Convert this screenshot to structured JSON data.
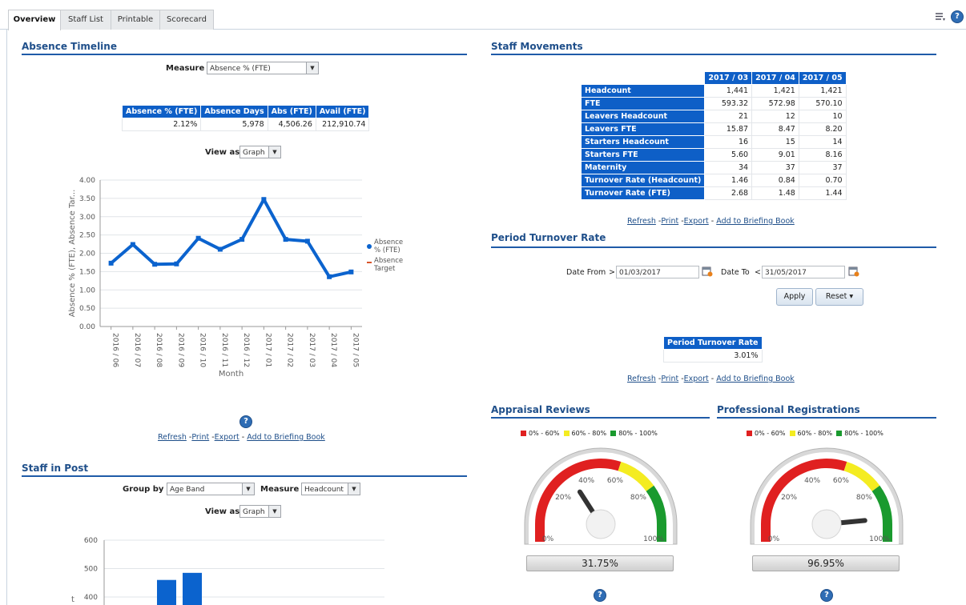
{
  "tabs": [
    "Overview",
    "Staff List",
    "Printable",
    "Scorecard"
  ],
  "absence_timeline": {
    "title": "Absence Timeline",
    "measure_label": "Measure",
    "measure_value": "Absence % (FTE)",
    "summary_headers": [
      "Absence % (FTE)",
      "Absence Days",
      "Abs (FTE)",
      "Avail (FTE)"
    ],
    "summary_values": [
      "2.12%",
      "5,978",
      "4,506.26",
      "212,910.74"
    ],
    "view_as_label": "View as",
    "view_as_value": "Graph",
    "links": {
      "refresh": "Refresh",
      "print": "Print",
      "export": "Export",
      "briefing": "Add to Briefing Book"
    }
  },
  "chart_data": {
    "type": "line",
    "categories": [
      "2016 / 06",
      "2016 / 07",
      "2016 / 08",
      "2016 / 09",
      "2016 / 10",
      "2016 / 11",
      "2016 / 12",
      "2017 / 01",
      "2017 / 02",
      "2017 / 03",
      "2017 / 04",
      "2017 / 05"
    ],
    "series": [
      {
        "name": "Absence % (FTE)",
        "values": [
          1.73,
          2.24,
          1.7,
          1.71,
          2.41,
          2.11,
          2.38,
          3.47,
          2.38,
          2.33,
          1.36,
          1.49
        ]
      },
      {
        "name": "Absence Target",
        "values": []
      }
    ],
    "ylabel": "Absence % (FTE), Absence Tar...",
    "xlabel": "Month",
    "ylim": [
      0,
      4
    ],
    "yticks": [
      "0.00",
      "0.50",
      "1.00",
      "1.50",
      "2.00",
      "2.50",
      "3.00",
      "3.50",
      "4.00"
    ],
    "legend": [
      "Absence % (FTE)",
      "Absence Target"
    ],
    "legend_position": "right",
    "colors": {
      "series": "#0b63ce",
      "target": "#d9542a"
    }
  },
  "staff_in_post": {
    "title": "Staff in Post",
    "group_by_label": "Group by",
    "group_by_value": "Age Band",
    "measure_label": "Measure",
    "measure_value": "Headcount",
    "view_as_label": "View as",
    "view_as_value": "Graph",
    "yticks": [
      "600",
      "500",
      "400"
    ],
    "ylabel_fragment": "t",
    "bars": [
      460,
      485
    ]
  },
  "staff_movements": {
    "title": "Staff Movements",
    "columns": [
      "2017 / 03",
      "2017 / 04",
      "2017 / 05"
    ],
    "rows": [
      {
        "label": "Headcount",
        "values": [
          "1,441",
          "1,421",
          "1,421"
        ]
      },
      {
        "label": "FTE",
        "values": [
          "593.32",
          "572.98",
          "570.10"
        ]
      },
      {
        "label": "Leavers Headcount",
        "values": [
          "21",
          "12",
          "10"
        ]
      },
      {
        "label": "Leavers FTE",
        "values": [
          "15.87",
          "8.47",
          "8.20"
        ]
      },
      {
        "label": "Starters Headcount",
        "values": [
          "16",
          "15",
          "14"
        ]
      },
      {
        "label": "Starters FTE",
        "values": [
          "5.60",
          "9.01",
          "8.16"
        ]
      },
      {
        "label": "Maternity",
        "values": [
          "34",
          "37",
          "37"
        ]
      },
      {
        "label": "Turnover Rate (Headcount)",
        "values": [
          "1.46",
          "0.84",
          "0.70"
        ]
      },
      {
        "label": "Turnover Rate (FTE)",
        "values": [
          "2.68",
          "1.48",
          "1.44"
        ]
      }
    ],
    "links": {
      "refresh": "Refresh",
      "print": "Print",
      "export": "Export",
      "briefing": "Add to Briefing Book"
    }
  },
  "period_turnover": {
    "title": "Period Turnover Rate",
    "date_from_label": "Date From",
    "date_from_op": ">",
    "date_from_value": "01/03/2017",
    "date_to_label": "Date To",
    "date_to_op": "<",
    "date_to_value": "31/05/2017",
    "apply": "Apply",
    "reset": "Reset",
    "table_header": "Period Turnover Rate",
    "table_value": "3.01%",
    "links": {
      "refresh": "Refresh",
      "print": "Print",
      "export": "Export",
      "briefing": "Add to Briefing Book"
    }
  },
  "gauges": [
    {
      "title": "Appraisal Reviews",
      "legend": [
        "0% - 60%",
        "60% - 80%",
        "80% - 100%"
      ],
      "ticks": [
        "0%",
        "20%",
        "40%",
        "60%",
        "80%",
        "100%"
      ],
      "value": 31.75,
      "readout": "31.75%"
    },
    {
      "title": "Professional Registrations",
      "legend": [
        "0% - 60%",
        "60% - 80%",
        "80% - 100%"
      ],
      "ticks": [
        "0%",
        "20%",
        "40%",
        "60%",
        "80%",
        "100%"
      ],
      "value": 96.95,
      "readout": "96.95%"
    }
  ],
  "colors": {
    "red": "#e02020",
    "yellow": "#f4ec21",
    "green": "#1a9a2e",
    "header_blue": "#0e5fc7",
    "title_blue": "#1f4f8a"
  },
  "icons": [
    "list-settings-icon",
    "help-icon",
    "calendar-icon",
    "dropdown-arrow-icon"
  ]
}
